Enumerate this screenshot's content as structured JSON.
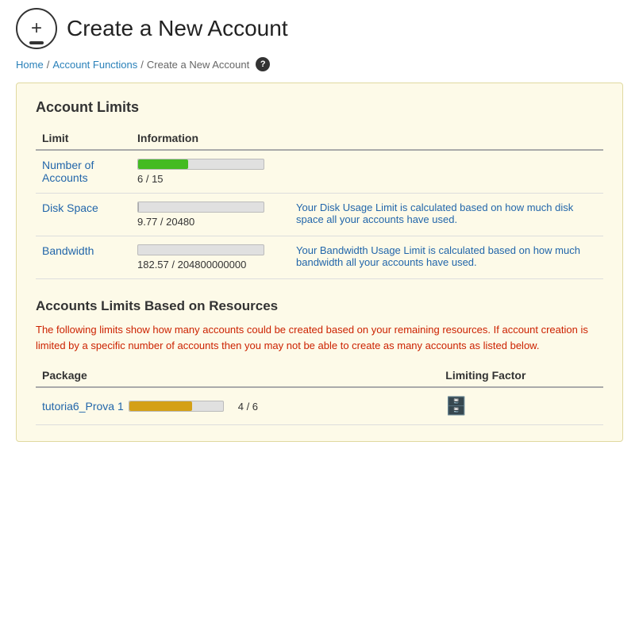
{
  "header": {
    "title": "Create a New Account",
    "icon": "+"
  },
  "breadcrumb": {
    "home": "Home",
    "account_functions": "Account Functions",
    "current": "Create a New Account"
  },
  "panel": {
    "account_limits_title": "Account Limits",
    "limits_col1": "Limit",
    "limits_col2": "Information",
    "limits": [
      {
        "label": "Number of Accounts",
        "current": 6,
        "max": 15,
        "bar_percent": 40,
        "bar_color": "bar-green",
        "value_text": "6 / 15",
        "info": ""
      },
      {
        "label": "Disk Space",
        "current": 9.77,
        "max": 20480,
        "bar_percent": 0.05,
        "bar_color": "bar-gray",
        "value_text": "9.77 / 20480",
        "info": "Your Disk Usage Limit is calculated based on how much disk space all your accounts have used."
      },
      {
        "label": "Bandwidth",
        "current": 182.57,
        "max": 204800000000,
        "bar_percent": 0.0001,
        "bar_color": "bar-gray",
        "value_text": "182.57 / 204800000000",
        "info": "Your Bandwidth Usage Limit is calculated based on how much bandwidth all your accounts have used."
      }
    ],
    "resources_title": "Accounts Limits Based on Resources",
    "resources_warning": "The following limits show how many accounts could be created based on your remaining resources. If account creation is limited by a specific number of accounts then you may not be able to create as many accounts as listed below.",
    "packages_col1": "Package",
    "packages_col2": "Limiting Factor",
    "packages": [
      {
        "name": "tutoria6_Prova 1",
        "bar_percent": 67,
        "bar_color": "bar-yellow",
        "value_text": "4 / 6",
        "limiting_factor_icon": "server"
      }
    ]
  }
}
